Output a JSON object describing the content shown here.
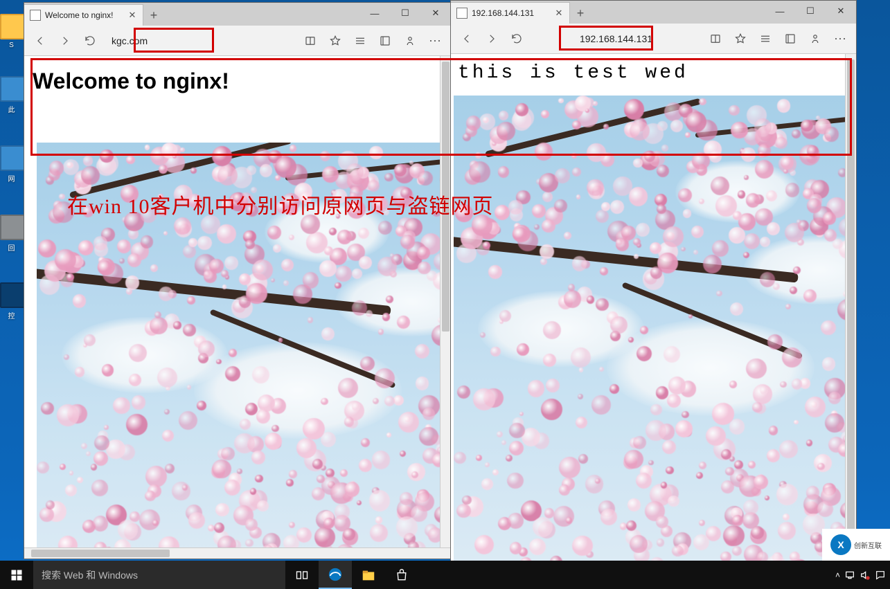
{
  "desktop_icons": [
    "S",
    "此",
    "网",
    "回",
    "控"
  ],
  "annotation": {
    "pre": "在",
    "eng": "win 10",
    "post": "客户机中分别访问原网页与盗链网页"
  },
  "windows": [
    {
      "tab_title": "Welcome to nginx!",
      "url": "kgc.com",
      "heading": "Welcome to nginx!",
      "heading_class": "h1"
    },
    {
      "tab_title": "192.168.144.131",
      "url": "192.168.144.131",
      "heading": "this is test wed",
      "heading_class": "test-h"
    }
  ],
  "window_controls": {
    "min": "—",
    "max": "☐",
    "close": "✕"
  },
  "tab_controls": {
    "close": "✕",
    "newtab": "+"
  },
  "toolbar": {
    "more": "···"
  },
  "taskbar": {
    "search_placeholder": "搜索 Web 和 Windows",
    "tray_up": "˄"
  },
  "watermark": {
    "logo": "X",
    "text": "创新互联"
  }
}
